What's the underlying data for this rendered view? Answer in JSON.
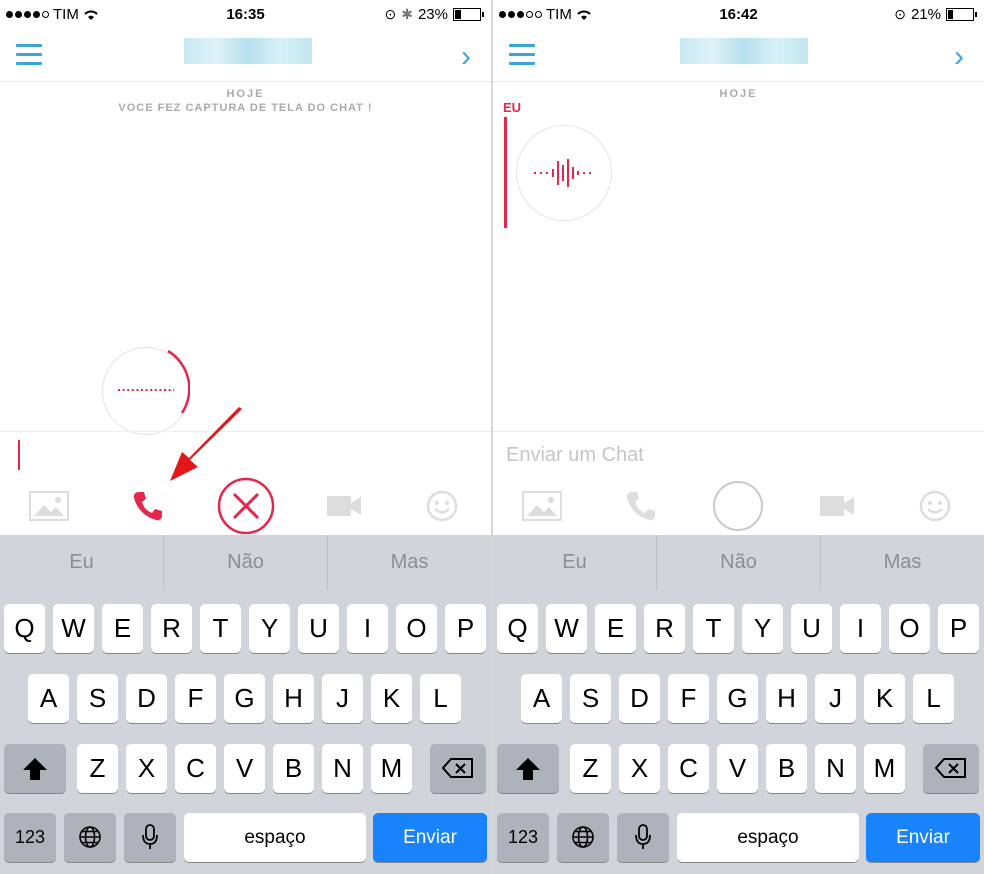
{
  "colors": {
    "accent": "#3aa5d8",
    "record_red": "#e3284c",
    "send_blue": "#1883fc"
  },
  "left": {
    "status": {
      "carrier": "TIM",
      "time": "16:35",
      "battery": "23%",
      "battery_level": 0.23
    },
    "day_label": "HOJE",
    "notice": "VOCE FEZ CAPTURA DE TELA DO CHAT !",
    "toolbar_icons": [
      "image-icon",
      "phone-icon",
      "cancel-icon",
      "video-icon",
      "emoji-icon"
    ]
  },
  "right": {
    "status": {
      "carrier": "TIM",
      "time": "16:42",
      "battery": "21%",
      "battery_level": 0.21
    },
    "day_label": "HOJE",
    "sender_label": "EU",
    "input_placeholder": "Enviar um Chat",
    "toolbar_icons": [
      "image-icon",
      "phone-icon",
      "record-button",
      "video-icon",
      "emoji-icon"
    ]
  },
  "keyboard": {
    "suggestions": [
      "Eu",
      "Não",
      "Mas"
    ],
    "row1": [
      "Q",
      "W",
      "E",
      "R",
      "T",
      "Y",
      "U",
      "I",
      "O",
      "P"
    ],
    "row2": [
      "A",
      "S",
      "D",
      "F",
      "G",
      "H",
      "J",
      "K",
      "L"
    ],
    "row3": [
      "Z",
      "X",
      "C",
      "V",
      "B",
      "N",
      "M"
    ],
    "numbers_key": "123",
    "space_key": "espaço",
    "send_key": "Enviar"
  }
}
